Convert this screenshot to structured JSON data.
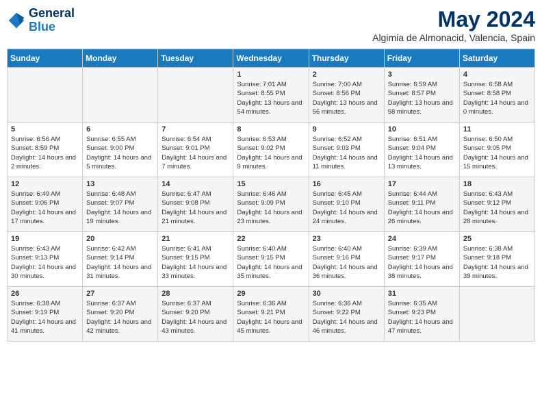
{
  "header": {
    "logo_general": "General",
    "logo_blue": "Blue",
    "month_title": "May 2024",
    "subtitle": "Algimia de Almonacid, Valencia, Spain"
  },
  "days_of_week": [
    "Sunday",
    "Monday",
    "Tuesday",
    "Wednesday",
    "Thursday",
    "Friday",
    "Saturday"
  ],
  "weeks": [
    [
      {
        "day": "",
        "info": ""
      },
      {
        "day": "",
        "info": ""
      },
      {
        "day": "",
        "info": ""
      },
      {
        "day": "1",
        "info": "Sunrise: 7:01 AM\nSunset: 8:55 PM\nDaylight: 13 hours\nand 54 minutes."
      },
      {
        "day": "2",
        "info": "Sunrise: 7:00 AM\nSunset: 8:56 PM\nDaylight: 13 hours\nand 56 minutes."
      },
      {
        "day": "3",
        "info": "Sunrise: 6:59 AM\nSunset: 8:57 PM\nDaylight: 13 hours\nand 58 minutes."
      },
      {
        "day": "4",
        "info": "Sunrise: 6:58 AM\nSunset: 8:58 PM\nDaylight: 14 hours\nand 0 minutes."
      }
    ],
    [
      {
        "day": "5",
        "info": "Sunrise: 6:56 AM\nSunset: 8:59 PM\nDaylight: 14 hours\nand 2 minutes."
      },
      {
        "day": "6",
        "info": "Sunrise: 6:55 AM\nSunset: 9:00 PM\nDaylight: 14 hours\nand 5 minutes."
      },
      {
        "day": "7",
        "info": "Sunrise: 6:54 AM\nSunset: 9:01 PM\nDaylight: 14 hours\nand 7 minutes."
      },
      {
        "day": "8",
        "info": "Sunrise: 6:53 AM\nSunset: 9:02 PM\nDaylight: 14 hours\nand 9 minutes."
      },
      {
        "day": "9",
        "info": "Sunrise: 6:52 AM\nSunset: 9:03 PM\nDaylight: 14 hours\nand 11 minutes."
      },
      {
        "day": "10",
        "info": "Sunrise: 6:51 AM\nSunset: 9:04 PM\nDaylight: 14 hours\nand 13 minutes."
      },
      {
        "day": "11",
        "info": "Sunrise: 6:50 AM\nSunset: 9:05 PM\nDaylight: 14 hours\nand 15 minutes."
      }
    ],
    [
      {
        "day": "12",
        "info": "Sunrise: 6:49 AM\nSunset: 9:06 PM\nDaylight: 14 hours\nand 17 minutes."
      },
      {
        "day": "13",
        "info": "Sunrise: 6:48 AM\nSunset: 9:07 PM\nDaylight: 14 hours\nand 19 minutes."
      },
      {
        "day": "14",
        "info": "Sunrise: 6:47 AM\nSunset: 9:08 PM\nDaylight: 14 hours\nand 21 minutes."
      },
      {
        "day": "15",
        "info": "Sunrise: 6:46 AM\nSunset: 9:09 PM\nDaylight: 14 hours\nand 23 minutes."
      },
      {
        "day": "16",
        "info": "Sunrise: 6:45 AM\nSunset: 9:10 PM\nDaylight: 14 hours\nand 24 minutes."
      },
      {
        "day": "17",
        "info": "Sunrise: 6:44 AM\nSunset: 9:11 PM\nDaylight: 14 hours\nand 26 minutes."
      },
      {
        "day": "18",
        "info": "Sunrise: 6:43 AM\nSunset: 9:12 PM\nDaylight: 14 hours\nand 28 minutes."
      }
    ],
    [
      {
        "day": "19",
        "info": "Sunrise: 6:43 AM\nSunset: 9:13 PM\nDaylight: 14 hours\nand 30 minutes."
      },
      {
        "day": "20",
        "info": "Sunrise: 6:42 AM\nSunset: 9:14 PM\nDaylight: 14 hours\nand 31 minutes."
      },
      {
        "day": "21",
        "info": "Sunrise: 6:41 AM\nSunset: 9:15 PM\nDaylight: 14 hours\nand 33 minutes."
      },
      {
        "day": "22",
        "info": "Sunrise: 6:40 AM\nSunset: 9:15 PM\nDaylight: 14 hours\nand 35 minutes."
      },
      {
        "day": "23",
        "info": "Sunrise: 6:40 AM\nSunset: 9:16 PM\nDaylight: 14 hours\nand 36 minutes."
      },
      {
        "day": "24",
        "info": "Sunrise: 6:39 AM\nSunset: 9:17 PM\nDaylight: 14 hours\nand 38 minutes."
      },
      {
        "day": "25",
        "info": "Sunrise: 6:38 AM\nSunset: 9:18 PM\nDaylight: 14 hours\nand 39 minutes."
      }
    ],
    [
      {
        "day": "26",
        "info": "Sunrise: 6:38 AM\nSunset: 9:19 PM\nDaylight: 14 hours\nand 41 minutes."
      },
      {
        "day": "27",
        "info": "Sunrise: 6:37 AM\nSunset: 9:20 PM\nDaylight: 14 hours\nand 42 minutes."
      },
      {
        "day": "28",
        "info": "Sunrise: 6:37 AM\nSunset: 9:20 PM\nDaylight: 14 hours\nand 43 minutes."
      },
      {
        "day": "29",
        "info": "Sunrise: 6:36 AM\nSunset: 9:21 PM\nDaylight: 14 hours\nand 45 minutes."
      },
      {
        "day": "30",
        "info": "Sunrise: 6:36 AM\nSunset: 9:22 PM\nDaylight: 14 hours\nand 46 minutes."
      },
      {
        "day": "31",
        "info": "Sunrise: 6:35 AM\nSunset: 9:23 PM\nDaylight: 14 hours\nand 47 minutes."
      },
      {
        "day": "",
        "info": ""
      }
    ]
  ]
}
